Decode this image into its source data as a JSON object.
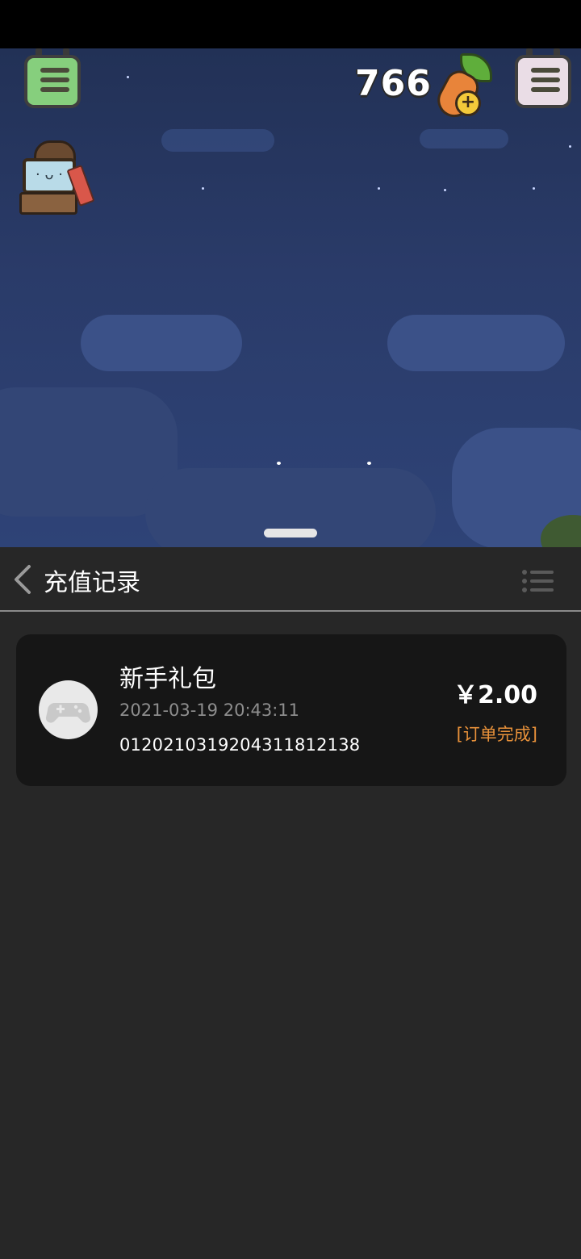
{
  "game": {
    "coin_count": "766"
  },
  "panel": {
    "title": "充值记录"
  },
  "orders": [
    {
      "name": "新手礼包",
      "time": "2021-03-19 20:43:11",
      "order_id": "0120210319204311812138",
      "amount": "￥2.00",
      "status": "[订单完成]"
    }
  ],
  "colors": {
    "status_accent": "#e8913a",
    "card_bg": "#161616",
    "panel_bg": "#272727"
  },
  "icons": {
    "back": "chevron-left-icon",
    "menu": "list-icon",
    "avatar": "gamepad-icon",
    "currency": "carrot-plus-icon"
  }
}
